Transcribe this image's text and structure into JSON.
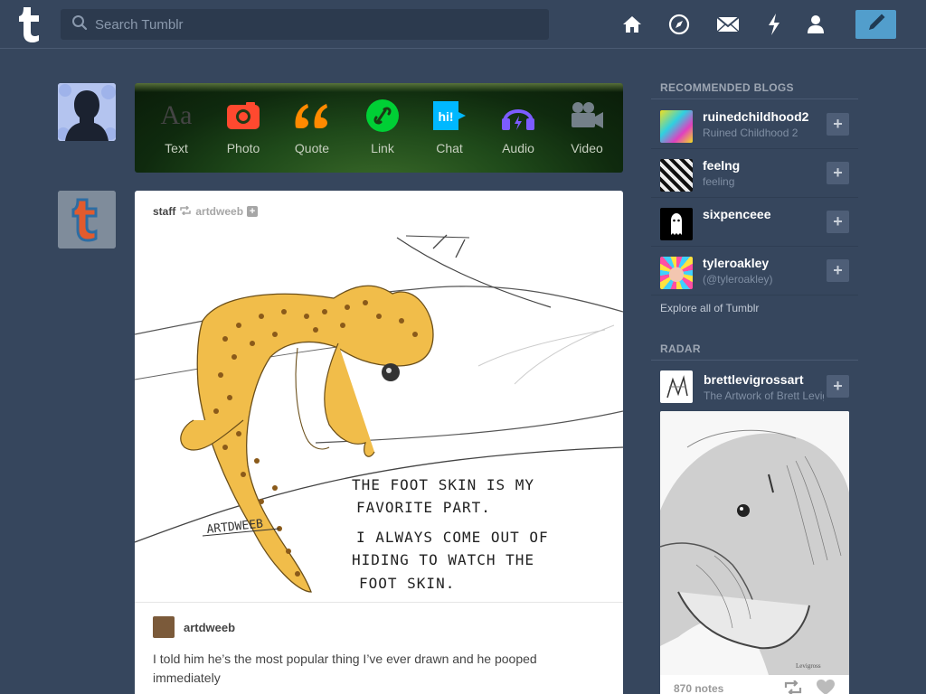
{
  "header": {
    "search_placeholder": "Search Tumblr",
    "nav_icons": [
      "home-icon",
      "explore-compass-icon",
      "inbox-icon",
      "activity-lightning-icon",
      "account-icon"
    ],
    "compose_icon": "pencil-icon",
    "accent_color": "#529ecc",
    "background_color": "#36465d"
  },
  "post_types": [
    {
      "label": "Text",
      "icon": "text-aa-icon",
      "color": "#444444"
    },
    {
      "label": "Photo",
      "icon": "camera-icon",
      "color": "#ff492f"
    },
    {
      "label": "Quote",
      "icon": "quote-icon",
      "color": "#ff8a00"
    },
    {
      "label": "Link",
      "icon": "link-icon",
      "color": "#00cf35"
    },
    {
      "label": "Chat",
      "icon": "chat-bubble-icon",
      "color": "#00b8ff"
    },
    {
      "label": "Audio",
      "icon": "headphones-icon",
      "color": "#7c5cff"
    },
    {
      "label": "Video",
      "icon": "video-camera-icon",
      "color": "#748089"
    }
  ],
  "post": {
    "author": "staff",
    "reblogged_from": "artdweeb",
    "drawing_text": [
      "THE FOOT SKIN IS MY",
      "FAVORITE PART.",
      "I ALWAYS COME OUT OF",
      "HIDING TO WATCH THE",
      "FOOT SKIN."
    ],
    "signature": "ARTDWEEB",
    "caption_user": "artdweeb",
    "caption": "I told him he’s the most popular thing I’ve ever drawn and he pooped immediately"
  },
  "sidebar": {
    "recommended_title": "RECOMMENDED BLOGS",
    "blogs": [
      {
        "name": "ruinedchildhood2",
        "subtitle": "Ruined Childhood 2"
      },
      {
        "name": "feelng",
        "subtitle": "feeling"
      },
      {
        "name": "sixpenceee",
        "subtitle": ""
      },
      {
        "name": "tyleroakley",
        "subtitle": "(@tyleroakley)"
      }
    ],
    "explore_link": "Explore all of Tumblr",
    "radar_title": "RADAR",
    "radar": {
      "name": "brettlevigrossart",
      "subtitle": "The Artwork of Brett Levigross",
      "notes": "870 notes"
    }
  }
}
